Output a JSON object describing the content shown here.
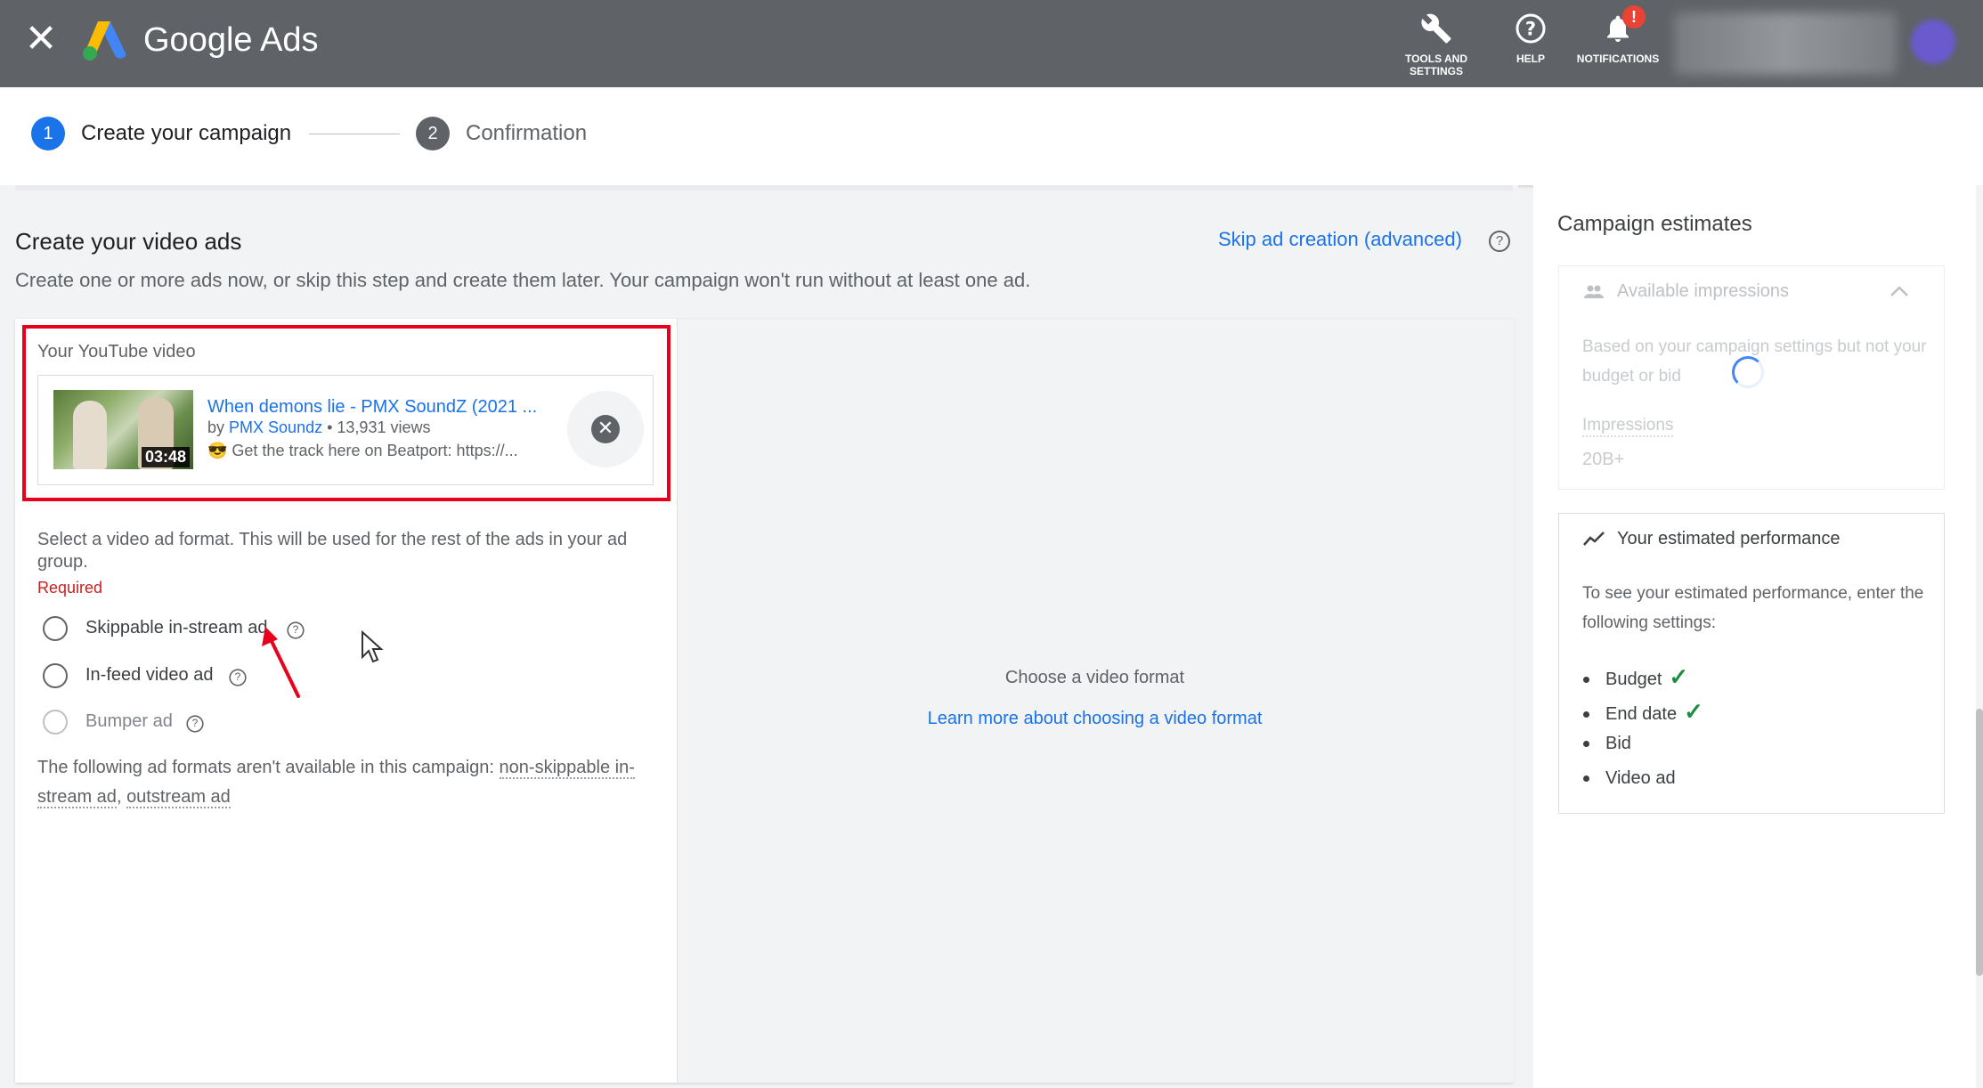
{
  "header": {
    "brand": "Google Ads",
    "tools_label_line1": "TOOLS AND",
    "tools_label_line2": "SETTINGS",
    "help_label": "HELP",
    "notifications_label": "NOTIFICATIONS",
    "notification_badge": "!"
  },
  "stepper": {
    "step1_number": "1",
    "step1_label": "Create your campaign",
    "step2_number": "2",
    "step2_label": "Confirmation"
  },
  "main": {
    "title": "Create your video ads",
    "description": "Create one or more ads now, or skip this step and create them later. Your campaign won't run without at least one ad.",
    "skip_link": "Skip ad creation (advanced)",
    "youtube_label": "Your YouTube video",
    "video": {
      "title": "When demons lie - PMX SoundZ (2021 ...",
      "by_prefix": "by",
      "channel": "PMX Soundz",
      "views": "• 13,931 views",
      "description": "😎 Get the track here on Beatport: https://...",
      "duration": "03:48"
    },
    "format_description": "Select a video ad format. This will be used for the rest of the ads in your ad group.",
    "required": "Required",
    "formats": [
      {
        "label": "Skippable in-stream ad"
      },
      {
        "label": "In-feed video ad"
      },
      {
        "label": "Bumper ad"
      }
    ],
    "unavailable_prefix": "The following ad formats aren't available in this campaign:",
    "unavailable_1": "non-skippable in-stream ad",
    "unavailable_sep": ",",
    "unavailable_2": "outstream ad",
    "choose_format": "Choose a video format",
    "learn_more": "Learn more about choosing a video format"
  },
  "side": {
    "title": "Campaign estimates",
    "impressions_header": "Available impressions",
    "impressions_text": "Based on your campaign settings but not your budget or bid",
    "impressions_label": "Impressions",
    "impressions_value": "20B+",
    "performance_header": "Your estimated performance",
    "performance_text": "To see your estimated performance, enter the following settings:",
    "items": [
      {
        "label": "Budget",
        "check": "✓"
      },
      {
        "label": "End date",
        "check": "✓"
      },
      {
        "label": "Bid",
        "check": ""
      },
      {
        "label": "Video ad",
        "check": ""
      }
    ]
  },
  "colors": {
    "topbar": "#5f6368",
    "accent_blue": "#1a73e8",
    "highlight_red": "#e8001c",
    "check_green": "#1e8e3e"
  }
}
